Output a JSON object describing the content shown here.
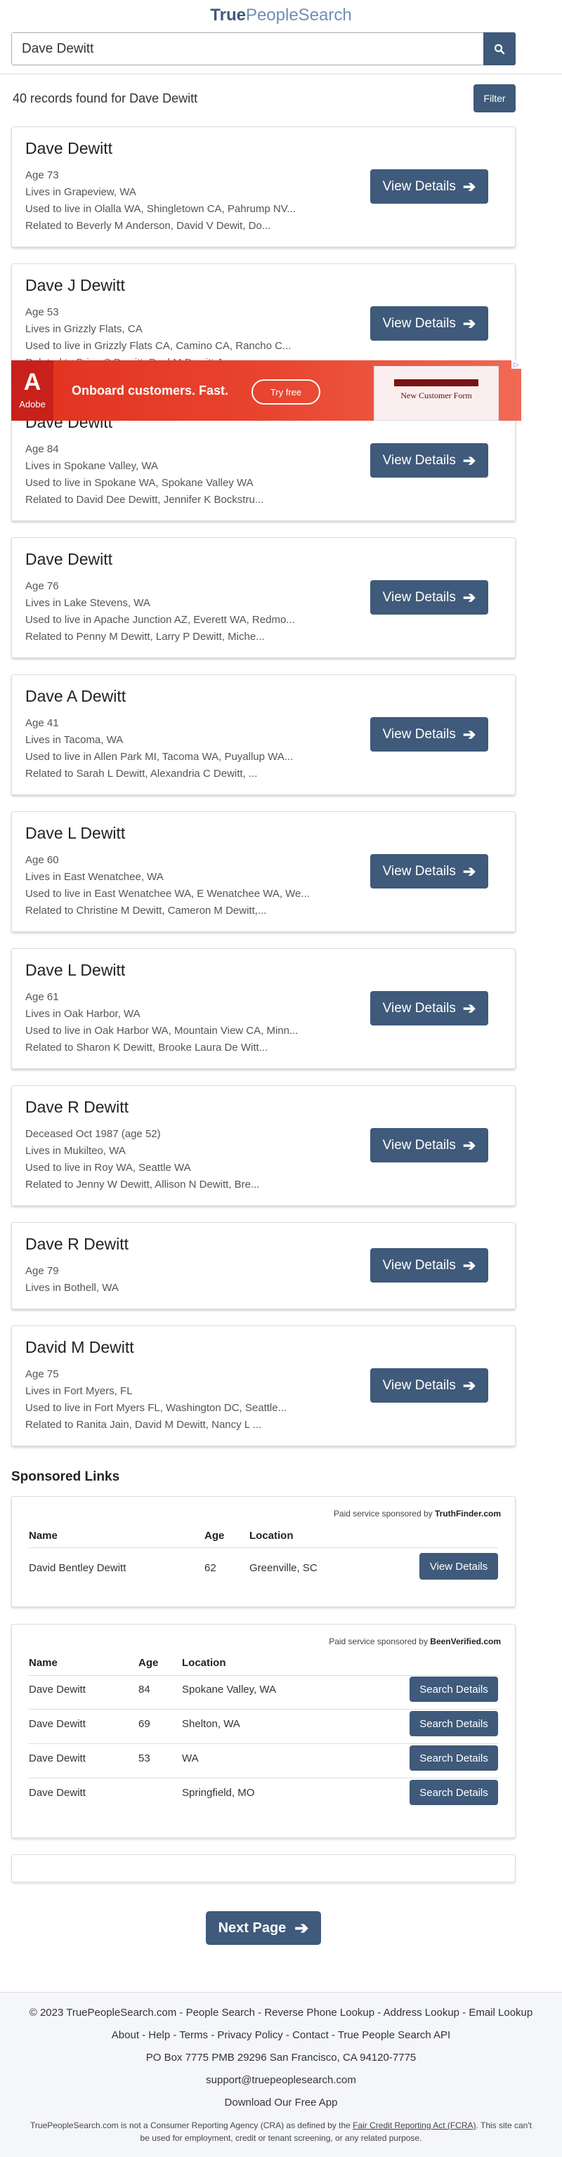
{
  "header": {
    "logo_true": "True",
    "logo_rest": "PeopleSearch",
    "search_value": "Dave Dewitt"
  },
  "results": {
    "count_text": "40 records found for Dave Dewitt",
    "filter_label": "Filter",
    "view_label": "View Details",
    "records": [
      {
        "name": "Dave Dewitt",
        "lines": [
          "Age 73",
          "Lives in Grapeview, WA",
          "Used to live in Olalla WA, Shingletown CA, Pahrump NV...",
          "Related to Beverly M Anderson, David V Dewit, Do..."
        ]
      },
      {
        "name": "Dave J Dewitt",
        "lines": [
          "Age 53",
          "Lives in Grizzly Flats, CA",
          "Used to live in Grizzly Flats CA, Camino CA, Rancho C...",
          "Related to Brian S Dewitt, Paul M Dewitt J..."
        ]
      },
      {
        "name": "Dave Dewitt",
        "lines": [
          "Age 84",
          "Lives in Spokane Valley, WA",
          "Used to live in Spokane WA, Spokane Valley WA",
          "Related to David Dee Dewitt, Jennifer K Bockstru..."
        ]
      },
      {
        "name": "Dave Dewitt",
        "lines": [
          "Age 76",
          "Lives in Lake Stevens, WA",
          "Used to live in Apache Junction AZ, Everett WA, Redmo...",
          "Related to Penny M Dewitt, Larry P Dewitt, Miche..."
        ]
      },
      {
        "name": "Dave A Dewitt",
        "lines": [
          "Age 41",
          "Lives in Tacoma, WA",
          "Used to live in Allen Park MI, Tacoma WA, Puyallup WA...",
          "Related to Sarah L Dewitt, Alexandria C Dewitt, ..."
        ]
      },
      {
        "name": "Dave L Dewitt",
        "lines": [
          "Age 60",
          "Lives in East Wenatchee, WA",
          "Used to live in East Wenatchee WA, E Wenatchee WA, We...",
          "Related to Christine M Dewitt, Cameron M Dewitt,..."
        ]
      },
      {
        "name": "Dave L Dewitt",
        "lines": [
          "Age 61",
          "Lives in Oak Harbor, WA",
          "Used to live in Oak Harbor WA, Mountain View CA, Minn...",
          "Related to Sharon K Dewitt, Brooke Laura De Witt..."
        ]
      },
      {
        "name": "Dave R Dewitt",
        "lines": [
          "Deceased Oct 1987 (age 52)",
          "Lives in Mukilteo, WA",
          "Used to live in Roy WA, Seattle WA",
          "Related to Jenny W Dewitt, Allison N Dewitt, Bre..."
        ]
      },
      {
        "name": "Dave R Dewitt",
        "lines": [
          "Age 79",
          "Lives in Bothell, WA"
        ]
      },
      {
        "name": "David M Dewitt",
        "lines": [
          "Age 75",
          "Lives in Fort Myers, FL",
          "Used to live in Fort Myers FL, Washington DC, Seattle...",
          "Related to Ranita Jain, David M Dewitt, Nancy L ..."
        ]
      }
    ]
  },
  "ad": {
    "brand": "Adobe",
    "headline": "Onboard customers. Fast.",
    "cta": "Try free",
    "preview_title": "New Customer Form"
  },
  "sponsored": {
    "title": "Sponsored Links",
    "truthfinder": {
      "credit_prefix": "Paid service sponsored by ",
      "credit_brand": "TruthFinder.com",
      "headers": [
        "Name",
        "Age",
        "Location"
      ],
      "rows": [
        {
          "name": "David Bentley Dewitt",
          "age": "62",
          "location": "Greenville, SC",
          "button": "View Details"
        }
      ]
    },
    "beenverified": {
      "credit_prefix": "Paid service sponsored by ",
      "credit_brand": "BeenVerified.com",
      "headers": [
        "Name",
        "Age",
        "Location"
      ],
      "rows": [
        {
          "name": "Dave Dewitt",
          "age": "84",
          "location": "Spokane Valley, WA",
          "button": "Search Details"
        },
        {
          "name": "Dave Dewitt",
          "age": "69",
          "location": "Shelton, WA",
          "button": "Search Details"
        },
        {
          "name": "Dave Dewitt",
          "age": "53",
          "location": "WA",
          "button": "Search Details"
        },
        {
          "name": "Dave Dewitt",
          "age": "",
          "location": "Springfield, MO",
          "button": "Search Details"
        }
      ]
    }
  },
  "pagination": {
    "next_label": "Next Page"
  },
  "footer": {
    "line1": "© 2023 TruePeopleSearch.com - People Search - Reverse Phone Lookup - Address Lookup - Email Lookup",
    "line2": "About - Help - Terms - Privacy Policy - Contact - True People Search API",
    "address": "PO Box 7775 PMB 29296 San Francisco, CA 94120-7775",
    "email": "support@truepeoplesearch.com",
    "app": "Download Our Free App",
    "disclaimer_a": "TruePeopleSearch.com is not a Consumer Reporting Agency (CRA) as defined by the ",
    "disclaimer_link": "Fair Credit Reporting Act (FCRA)",
    "disclaimer_b": ". This site can't",
    "disclaimer_c": "be used for employment, credit or tenant screening, or any related purpose."
  },
  "colors": {
    "accent": "#3f5a7a",
    "logo_light": "#6f8fb8"
  }
}
